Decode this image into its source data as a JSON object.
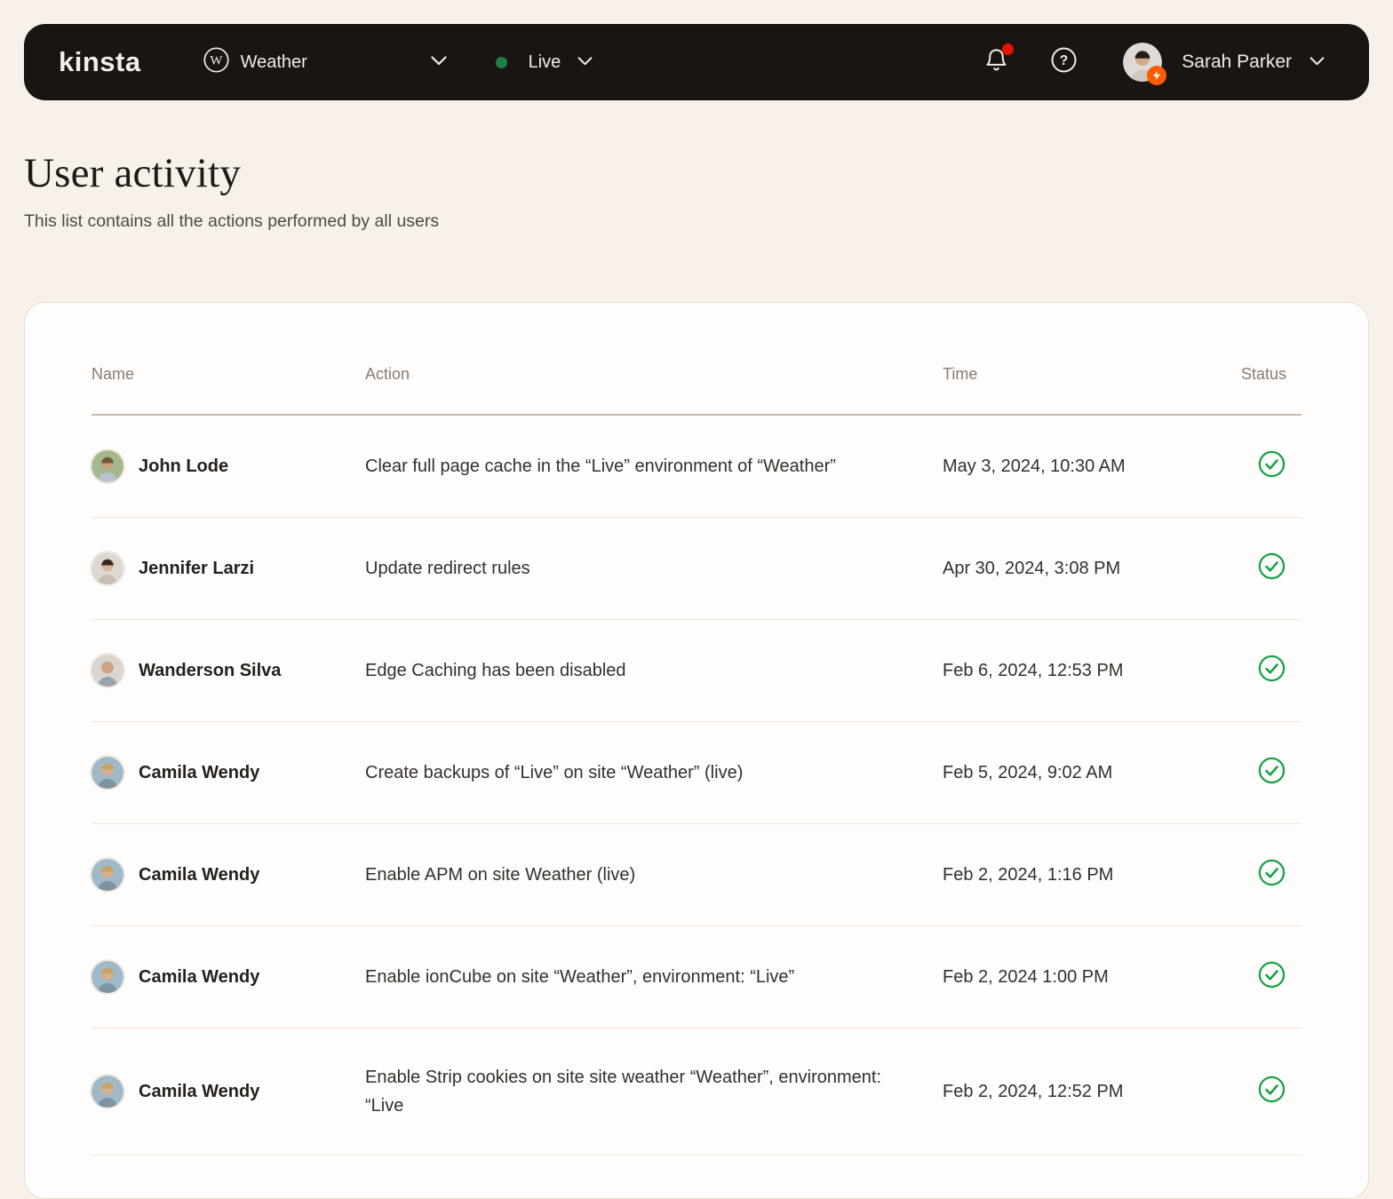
{
  "theme": {
    "bg": "#f7f1ea",
    "navbar_bg": "#1a1513",
    "navbar_text": "#f2ece4",
    "live_green": "#1e8043",
    "status_green": "#16a348",
    "notification_red": "#e51400",
    "badge_orange": "#ff5c00",
    "card_bg": "#fffdfb",
    "card_border": "#eaddd0",
    "thead_text": "#8b7b70",
    "thead_border": "#cbb9a7",
    "row_border": "#f0e4d9",
    "text_name": "#24201d",
    "text_body": "#332f2c",
    "text_subtitle": "#4f4a45",
    "text_title": "#1e1a17"
  },
  "navbar": {
    "logo": "kinsta",
    "site_selector": {
      "icon": "wordpress-icon",
      "label": "Weather"
    },
    "env_selector": {
      "status_icon": "green-dot",
      "label": "Live"
    },
    "notification_icon": "bell-icon-with-red-dot",
    "help_icon": "question-circle-icon",
    "user": {
      "name": "Sarah Parker",
      "badge_icon": "lightning-bolt",
      "avatar": {
        "bg": "#dfdad5",
        "skin": "#d3a98c",
        "hair": "#241d1a",
        "shirt": "#cfc8c1"
      }
    }
  },
  "page": {
    "title": "User activity",
    "subtitle": "This list contains all the actions performed by all users"
  },
  "table": {
    "columns": [
      "Name",
      "Action",
      "Time",
      "Status"
    ],
    "rows": [
      {
        "name": "John Lode",
        "action": "Clear full page cache in the “Live” environment of “Weather”",
        "time": "May 3, 2024, 10:30 AM",
        "status": "success",
        "avatar": {
          "bg": "#a3b88c",
          "skin": "#c9a07c",
          "hair": "#6e563f",
          "shirt": "#b9c3cd"
        }
      },
      {
        "name": "Jennifer Larzi",
        "action": "Update redirect rules",
        "time": "Apr 30, 2024, 3:08 PM",
        "status": "success",
        "avatar": {
          "bg": "#ded8d3",
          "skin": "#d9b59c",
          "hair": "#35281f",
          "shirt": "#c9bdb2"
        }
      },
      {
        "name": "Wanderson Silva",
        "action": "Edge Caching has been disabled",
        "time": "Feb 6, 2024, 12:53 PM",
        "status": "success",
        "avatar": {
          "bg": "#d9d4cf",
          "skin": "#cfa282",
          "hair": "#cfa282",
          "shirt": "#9aa3ab"
        }
      },
      {
        "name": "Camila Wendy",
        "action": "Create backups of “Live” on site “Weather” (live)",
        "time": "Feb 5, 2024, 9:02 AM",
        "status": "success",
        "avatar": {
          "bg": "#9fb9c9",
          "skin": "#d8ae8d",
          "hair": "#c9a366",
          "shirt": "#7f94a3"
        }
      },
      {
        "name": "Camila Wendy",
        "action": "Enable APM on site Weather (live)",
        "time": "Feb 2, 2024, 1:16 PM",
        "status": "success",
        "avatar": {
          "bg": "#9fb9c9",
          "skin": "#d8ae8d",
          "hair": "#c9a366",
          "shirt": "#7f94a3"
        }
      },
      {
        "name": "Camila Wendy",
        "action": "Enable ionCube on site “Weather”, environment: “Live”",
        "time": "Feb 2, 2024 1:00 PM",
        "status": "success",
        "avatar": {
          "bg": "#9fb9c9",
          "skin": "#d8ae8d",
          "hair": "#c9a366",
          "shirt": "#7f94a3"
        }
      },
      {
        "name": "Camila Wendy",
        "action": "Enable Strip cookies on site site weather “Weather”, environment: “Live",
        "time": "Feb 2, 2024, 12:52 PM",
        "status": "success",
        "avatar": {
          "bg": "#9fb9c9",
          "skin": "#d8ae8d",
          "hair": "#c9a366",
          "shirt": "#7f94a3"
        }
      }
    ]
  }
}
